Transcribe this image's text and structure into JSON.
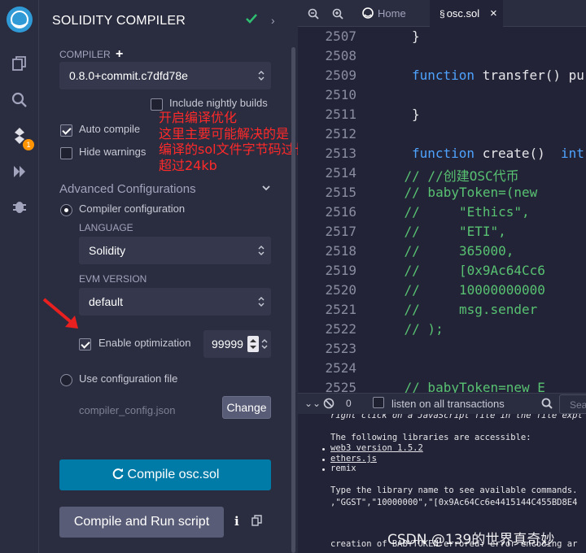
{
  "icon_panel": {
    "plugins_badge": "1"
  },
  "compiler_panel": {
    "title": "SOLIDITY COMPILER",
    "compiler_label": "COMPILER",
    "compiler_version": "0.8.0+commit.c7dfd78e",
    "include_nightly_label": "Include nightly builds",
    "auto_compile_label": "Auto compile",
    "hide_warnings_label": "Hide warnings",
    "advanced_label": "Advanced Configurations",
    "compiler_config_label": "Compiler configuration",
    "language_label": "LANGUAGE",
    "language_value": "Solidity",
    "evm_label": "EVM VERSION",
    "evm_value": "default",
    "enable_optimization_label": "Enable optimization",
    "runs_value": "99999",
    "use_config_file_label": "Use configuration file",
    "config_file_path": "compiler_config.json",
    "change_button": "Change",
    "compile_button": "Compile osc.sol",
    "compile_run_button": "Compile and Run script"
  },
  "annotation": {
    "line1": "开启编译优化",
    "line2": "这里主要可能解决的是",
    "line3": "编译的sol文件字节码过长",
    "line4": "超过24kb"
  },
  "tabs": {
    "home": "Home",
    "file": "osc.sol"
  },
  "editor": {
    "lines": [
      {
        "n": "2507",
        "t": "}"
      },
      {
        "n": "2508",
        "t": ""
      },
      {
        "n": "2509",
        "kw": "function",
        "t": " transfer() pu"
      },
      {
        "n": "2510",
        "t": ""
      },
      {
        "n": "2511",
        "t": "}"
      },
      {
        "n": "2512",
        "t": ""
      },
      {
        "n": "2513",
        "kw": "function",
        "t": " create()  ",
        "kw2": "int"
      },
      {
        "n": "2514",
        "cm": "    // //创建OSC代币"
      },
      {
        "n": "2515",
        "cm": "    // babyToken=(new"
      },
      {
        "n": "2516",
        "cm": "    //     \"Ethics\","
      },
      {
        "n": "2517",
        "cm": "    //     \"ETI\","
      },
      {
        "n": "2518",
        "cm": "    //     365000,"
      },
      {
        "n": "2519",
        "cm": "    //     [0x9Ac64Cc6"
      },
      {
        "n": "2520",
        "cm": "    //     10000000000"
      },
      {
        "n": "2521",
        "cm": "    //     msg.sender"
      },
      {
        "n": "2522",
        "cm": "    // );"
      },
      {
        "n": "2523",
        "t": ""
      },
      {
        "n": "2524",
        "t": ""
      },
      {
        "n": "2525",
        "cm": "    // babyToken=new E"
      }
    ]
  },
  "terminal": {
    "tx_count": "0",
    "listen_label": "listen on all transactions",
    "search_placeholder": "Sea",
    "line_partial": "right click on a JavaScript file in the file expl",
    "libs_header": "The following libraries are accessible:",
    "lib1": "web3 version 1.5.2",
    "lib2": "ethers.js",
    "lib3": "remix",
    "help_line": "Type the library name to see available commands.",
    "args_line": ",\"GGST\",\"10000000\",\"[0x9Ac64Cc6e4415144C455BD8E4",
    "error_line": "creation of BABYTOKEN errored: error encoding ar"
  },
  "watermark": "CSDN @139的世界真奇妙"
}
